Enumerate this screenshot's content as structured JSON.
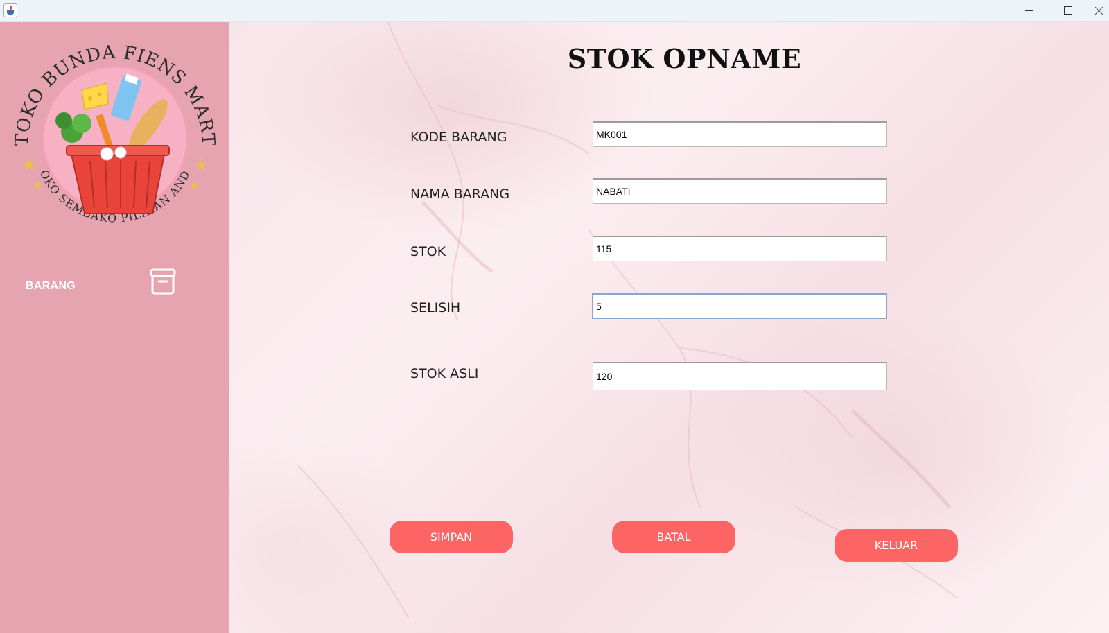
{
  "window": {
    "controls": {
      "minimize": "minimize-icon",
      "maximize": "maximize-icon",
      "close": "close-icon"
    }
  },
  "sidebar": {
    "logo": {
      "top_text": "TOKO BUNDA FIENS MART",
      "bottom_text": "TOKO SEMBAKO PILIHAN ANDA"
    },
    "items": [
      {
        "label": "BARANG",
        "icon": "box-icon"
      }
    ]
  },
  "main": {
    "title": "STOK OPNAME",
    "fields": [
      {
        "label": "KODE BARANG",
        "value": "MK001"
      },
      {
        "label": "NAMA BARANG",
        "value": "NABATI"
      },
      {
        "label": "STOK",
        "value": "115"
      },
      {
        "label": "SELISIH",
        "value": "5"
      },
      {
        "label": "STOK ASLI",
        "value": "120"
      }
    ],
    "buttons": {
      "simpan": "SIMPAN",
      "batal": "BATAL",
      "keluar": "KELUAR"
    }
  },
  "colors": {
    "sidebar_bg": "#e6a4b1",
    "button_bg": "#fd6464",
    "button_text": "#ffffff",
    "focus_border": "#8aa6cf"
  }
}
